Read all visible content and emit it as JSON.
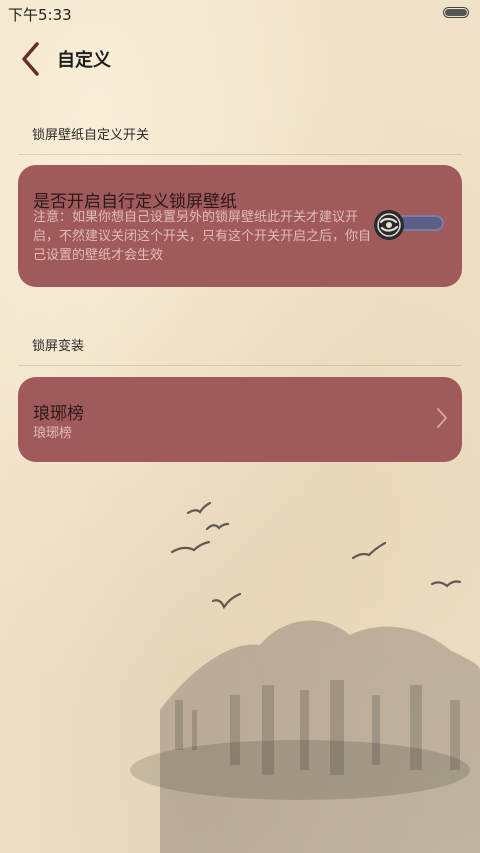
{
  "status_bar": {
    "time": "下午5:33",
    "battery_level_percent": 100
  },
  "header": {
    "title": "自定义",
    "back_icon": "chevron-left-icon"
  },
  "section_wallpaper": {
    "label": "锁屏壁纸自定义开关",
    "card": {
      "title": "是否开启自行定义锁屏壁纸",
      "description": "注意：如果你想自己设置另外的锁屏壁纸此开关才建议开启，不然建议关闭这个开关，只有这个开关开启之后，你自己设置的壁纸才会生效",
      "toggle_on": false
    }
  },
  "section_style": {
    "label": "锁屏变装",
    "item": {
      "title": "琅琊榜",
      "subtitle": "琅琊榜",
      "arrow_icon": "chevron-right-icon"
    }
  },
  "colors": {
    "card": "#a05a5c",
    "background": "#f0e2c8",
    "toggle_track": "#5b5f86"
  }
}
